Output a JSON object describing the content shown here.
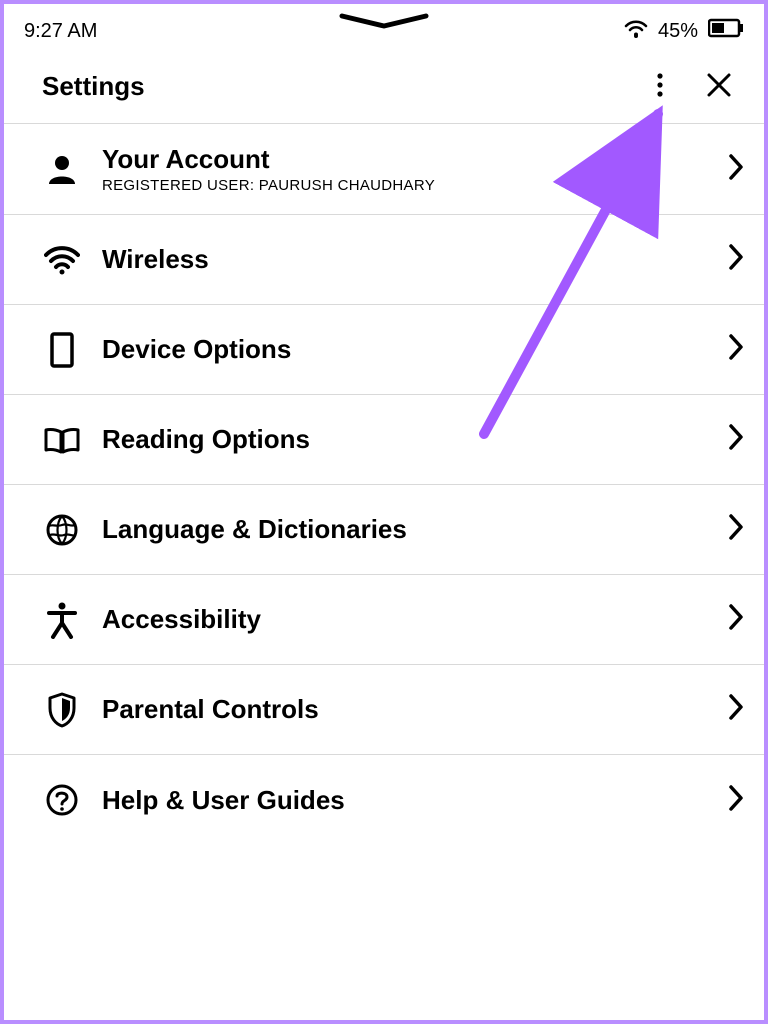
{
  "status": {
    "time": "9:27 AM",
    "battery_pct": "45%"
  },
  "header": {
    "title": "Settings"
  },
  "rows": {
    "account": {
      "title": "Your Account",
      "sub": "REGISTERED USER: PAURUSH CHAUDHARY"
    },
    "wireless": {
      "title": "Wireless"
    },
    "device": {
      "title": "Device Options"
    },
    "reading": {
      "title": "Reading Options"
    },
    "language": {
      "title": "Language & Dictionaries"
    },
    "accessibility": {
      "title": "Accessibility"
    },
    "parental": {
      "title": "Parental Controls"
    },
    "help": {
      "title": "Help & User Guides"
    }
  }
}
